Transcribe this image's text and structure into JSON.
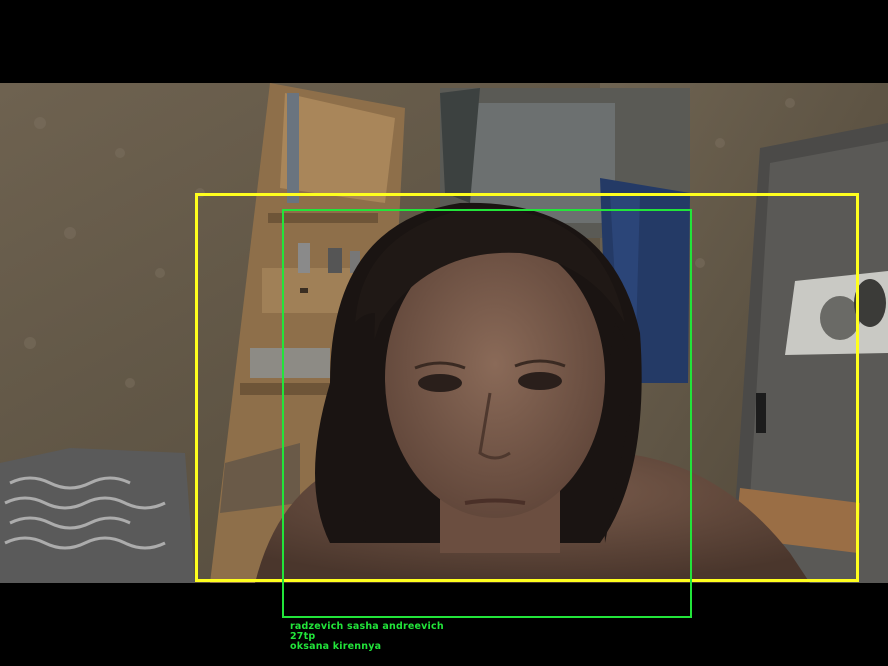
{
  "frame": {
    "background": "#000000",
    "detector_box_color": "#ffff1e",
    "face_box_color": "#22e43a"
  },
  "scene": {
    "description_icon": "webcam-portrait-photo"
  },
  "caption": {
    "name_line": "radzevich sasha andreevich",
    "group_line": "27tp",
    "teacher_line": "oksana kirennya"
  }
}
